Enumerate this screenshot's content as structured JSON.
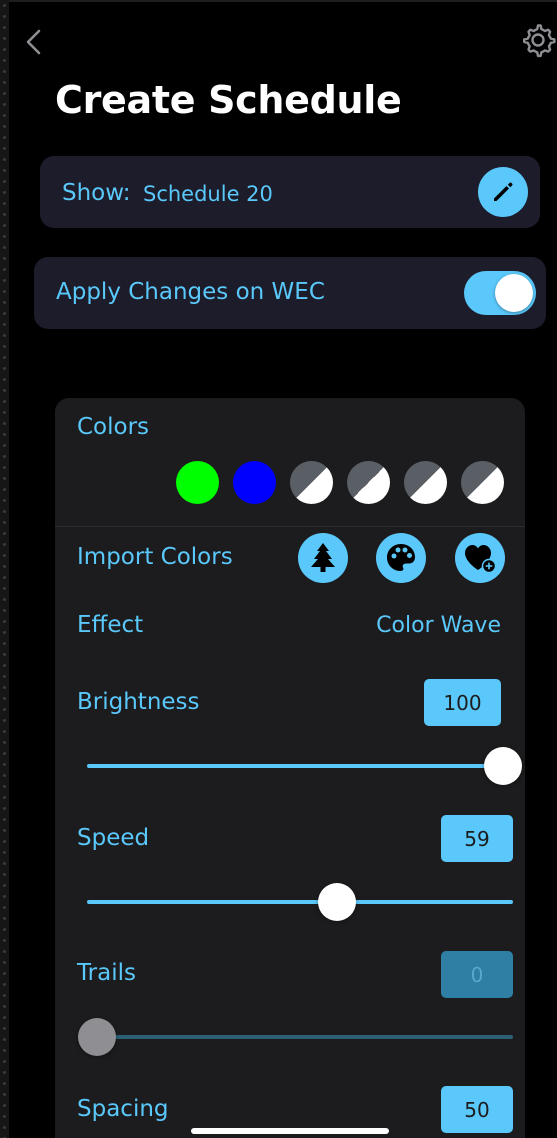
{
  "header": {
    "title": "Create Schedule",
    "back_icon": "chevron-left-icon",
    "settings_icon": "gear-icon"
  },
  "show": {
    "label": "Show:",
    "value": "Schedule 20",
    "edit_icon": "pencil-icon"
  },
  "apply": {
    "label": "Apply Changes on WEC",
    "enabled": true
  },
  "colors": {
    "label": "Colors",
    "swatches": [
      "#00ff00",
      "#0000ff",
      "empty",
      "empty",
      "empty",
      "empty"
    ]
  },
  "import_colors": {
    "label": "Import Colors",
    "icons": [
      "tree-icon",
      "palette-icon",
      "heart-plus-icon"
    ]
  },
  "effect": {
    "label": "Effect",
    "value": "Color Wave"
  },
  "brightness": {
    "label": "Brightness",
    "value": "100",
    "fraction": 1.0
  },
  "speed": {
    "label": "Speed",
    "value": "59",
    "fraction": 0.59
  },
  "trails": {
    "label": "Trails",
    "value": "0",
    "fraction": 0.0,
    "disabled": true
  },
  "spacing": {
    "label": "Spacing",
    "value": "50"
  },
  "theme": {
    "accent": "#5ac8fa",
    "background": "#000000",
    "card": "#1c1c2a",
    "panel": "#1c1c1e"
  }
}
